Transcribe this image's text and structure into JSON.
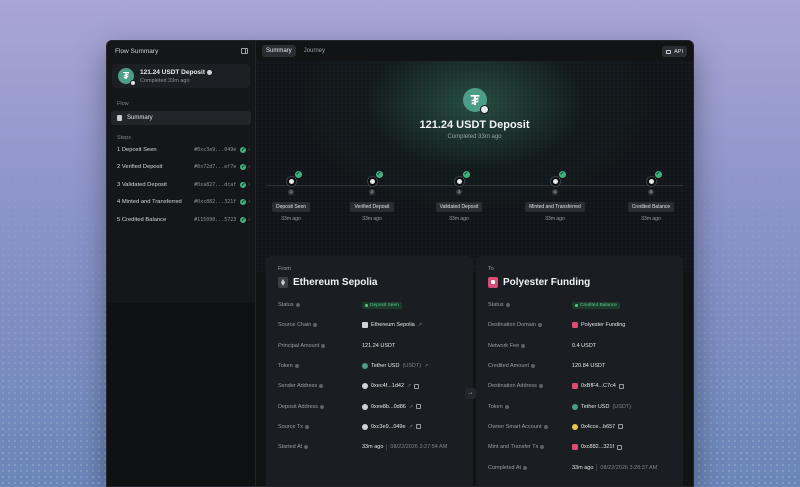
{
  "sidebar": {
    "title": "Flow Summary",
    "card": {
      "title": "121.24 USDT Deposit",
      "subtitle": "Completed 33m ago"
    },
    "flow_section": "Flow",
    "summary_item": "Summary",
    "steps_section": "Steps",
    "steps": [
      {
        "label": "1  Deposit Seen",
        "hash": "#0xc3e9...049e"
      },
      {
        "label": "2  Verified Deposit",
        "hash": "#0x72d7...ef7e"
      },
      {
        "label": "3  Validated Deposit",
        "hash": "#0xa827...dcaf"
      },
      {
        "label": "4  Minted and Transferred",
        "hash": "#0xc882...321f"
      },
      {
        "label": "5  Credited Balance",
        "hash": "#115090...5723"
      }
    ]
  },
  "tabs": [
    "Summary",
    "Journey"
  ],
  "api_label": "API",
  "hero": {
    "title": "121.24 USDT Deposit",
    "subtitle": "Completed 33m ago"
  },
  "timeline": [
    {
      "label": "Deposit Seen",
      "time": "33m ago",
      "num": "1"
    },
    {
      "label": "Verified Deposit",
      "time": "33m ago",
      "num": "2"
    },
    {
      "label": "Validated Deposit",
      "time": "33m ago",
      "num": "3"
    },
    {
      "label": "Minted and Transferred",
      "time": "33m ago",
      "num": "4"
    },
    {
      "label": "Credited Balance",
      "time": "33m ago",
      "num": "5"
    }
  ],
  "from": {
    "caption": "From",
    "title": "Ethereum Sepolia",
    "rows": {
      "status": {
        "label": "Status",
        "value": "Deposit Seen"
      },
      "source_chain": {
        "label": "Source Chain",
        "value": "Ethereum Sepolia"
      },
      "principal": {
        "label": "Principal Amount",
        "value": "121.24 USDT"
      },
      "token": {
        "label": "Token",
        "value": "Tether USD",
        "symbol": "(USDT)"
      },
      "sender": {
        "label": "Sender Address",
        "value": "0xec4f...1d42"
      },
      "deposit": {
        "label": "Deposit Address",
        "value": "0xee8b...0d86"
      },
      "source_tx": {
        "label": "Source Tx",
        "value": "0xc3e9...049e"
      },
      "started": {
        "label": "Started At",
        "value": "33m ago",
        "date": "08/22/2026 3:27:54 AM"
      }
    }
  },
  "to": {
    "caption": "To",
    "title": "Polyester Funding",
    "rows": {
      "status": {
        "label": "Status",
        "value": "Credited Balance"
      },
      "dest_domain": {
        "label": "Destination Domain",
        "value": "Polyester Funding"
      },
      "fee": {
        "label": "Network Fee",
        "value": "0.4 USDT"
      },
      "credited": {
        "label": "Credited Amount",
        "value": "120.84 USDT"
      },
      "dest_addr": {
        "label": "Destination Address",
        "value": "0xBfF4...C7c4"
      },
      "token": {
        "label": "Token",
        "value": "Tether USD",
        "symbol": "(USDT)"
      },
      "owner": {
        "label": "Owner Smart Account",
        "value": "0x4cce...b657"
      },
      "mint_tx": {
        "label": "Mint and Transfer Tx",
        "value": "0xc882...321f"
      },
      "completed": {
        "label": "Completed At",
        "value": "33m ago",
        "date": "08/22/2026 3:28:37 AM"
      }
    }
  },
  "colors": {
    "accent_green": "#3fb27f",
    "tether": "#4a9d86",
    "polyester": "#d94b73"
  }
}
